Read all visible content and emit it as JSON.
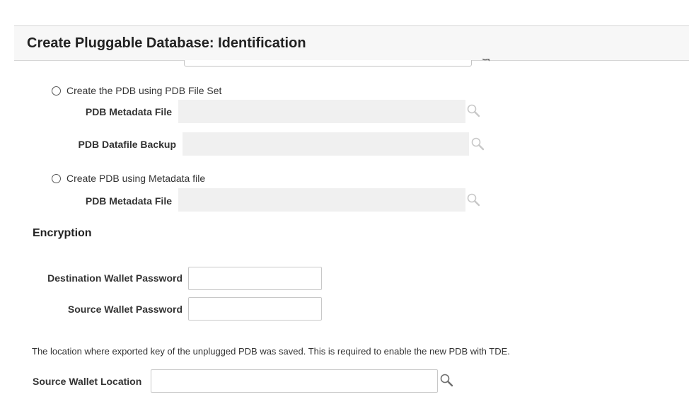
{
  "page": {
    "title": "Create Pluggable Database: Identification"
  },
  "pdb_file_set": {
    "radio_label": "Create the PDB using PDB File Set",
    "selected": false,
    "metadata_file_label": "PDB Metadata File",
    "metadata_file_value": "",
    "datafile_backup_label": "PDB Datafile Backup",
    "datafile_backup_value": ""
  },
  "metadata_file_option": {
    "radio_label": "Create PDB using Metadata file",
    "selected": false,
    "metadata_file_label": "PDB Metadata File",
    "metadata_file_value": ""
  },
  "encryption": {
    "section_title": "Encryption",
    "destination_wallet_password_label": "Destination Wallet Password",
    "destination_wallet_password_value": "",
    "source_wallet_password_label": "Source Wallet Password",
    "source_wallet_password_value": "",
    "info_text": "The location where exported key of the unplugged PDB was saved. This is required to enable the new PDB with TDE.",
    "source_wallet_location_label": "Source Wallet Location",
    "source_wallet_location_value": ""
  },
  "icons": {
    "search": "search-icon"
  },
  "colors": {
    "header_bg": "#f7f7f7",
    "disabled_field_bg": "#f0f0f0",
    "icon_enabled": "#707070",
    "icon_disabled": "#c8c8c8"
  }
}
